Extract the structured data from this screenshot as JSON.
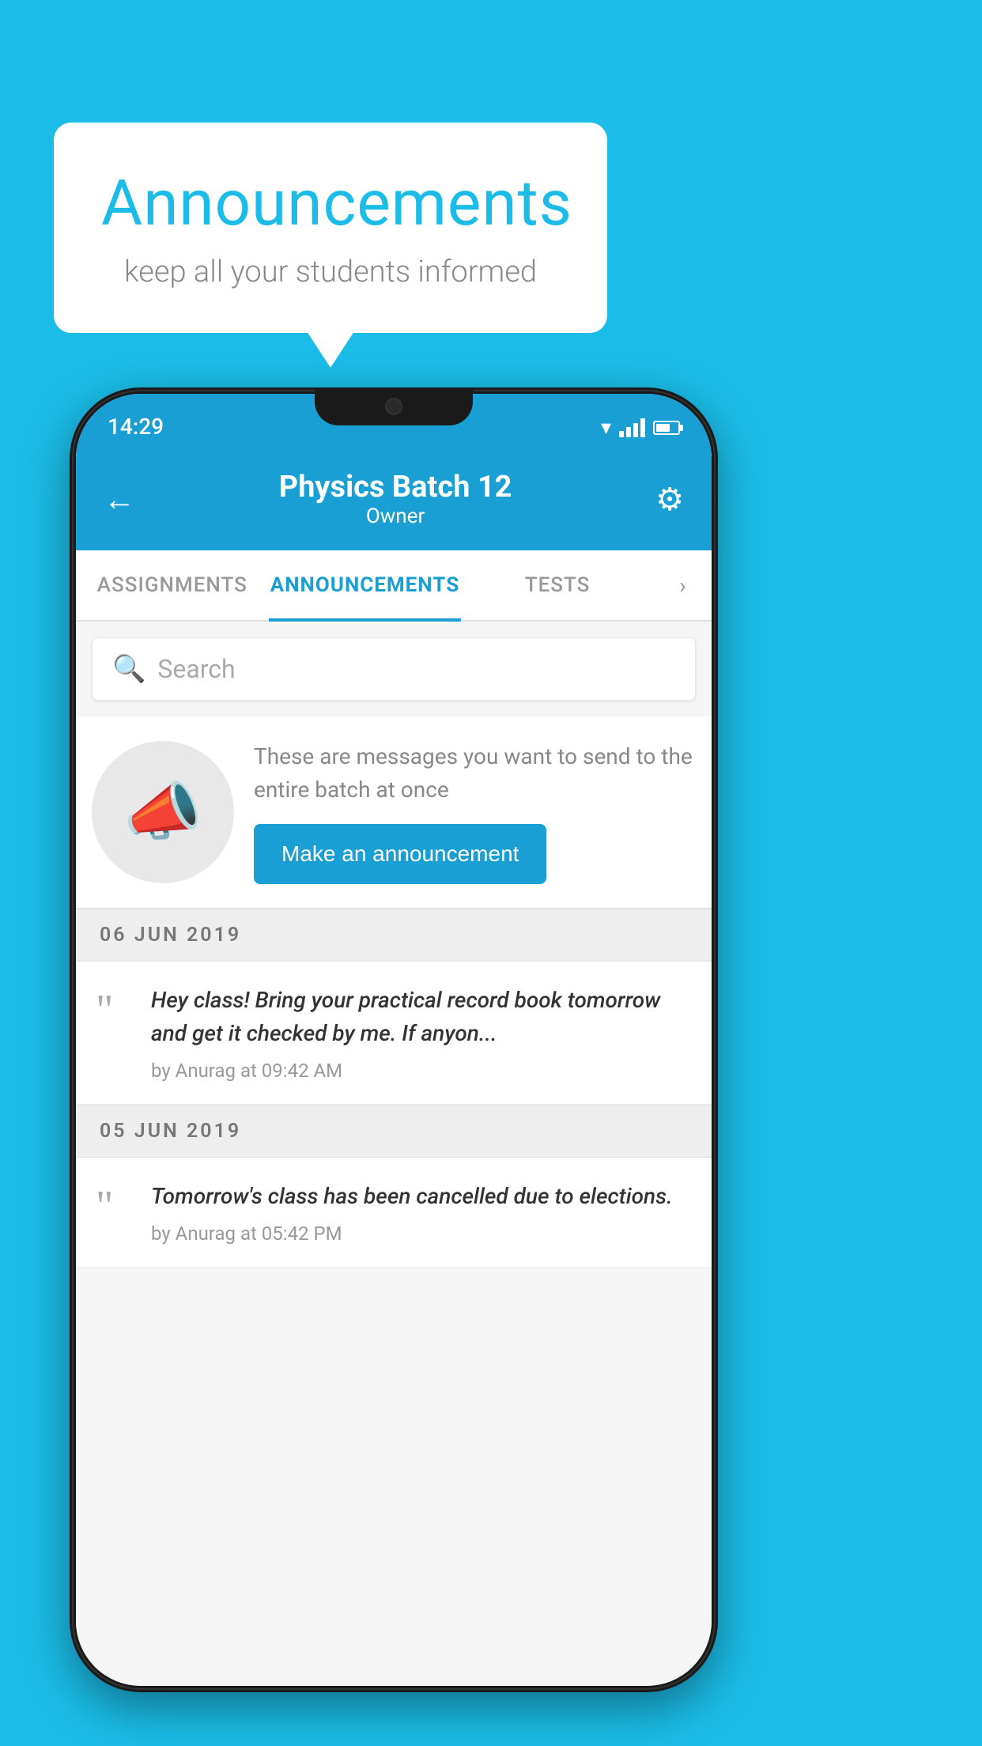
{
  "background_color": "#1BBDE8",
  "speech_bubble": {
    "title": "Announcements",
    "subtitle": "keep all your students informed"
  },
  "phone": {
    "status_bar": {
      "time": "14:29"
    },
    "header": {
      "title": "Physics Batch 12",
      "subtitle": "Owner",
      "back_label": "←",
      "gear_label": "⚙"
    },
    "tabs": [
      {
        "label": "ASSIGNMENTS",
        "active": false
      },
      {
        "label": "ANNOUNCEMENTS",
        "active": true
      },
      {
        "label": "TESTS",
        "active": false
      }
    ],
    "search": {
      "placeholder": "Search"
    },
    "cta": {
      "description": "These are messages you want to send to the entire batch at once",
      "button_label": "Make an announcement"
    },
    "announcements": [
      {
        "date": "06  JUN  2019",
        "text": "Hey class! Bring your practical record book tomorrow and get it checked by me. If anyon...",
        "meta": "by Anurag at 09:42 AM"
      },
      {
        "date": "05  JUN  2019",
        "text": "Tomorrow's class has been cancelled due to elections.",
        "meta": "by Anurag at 05:42 PM"
      }
    ]
  }
}
